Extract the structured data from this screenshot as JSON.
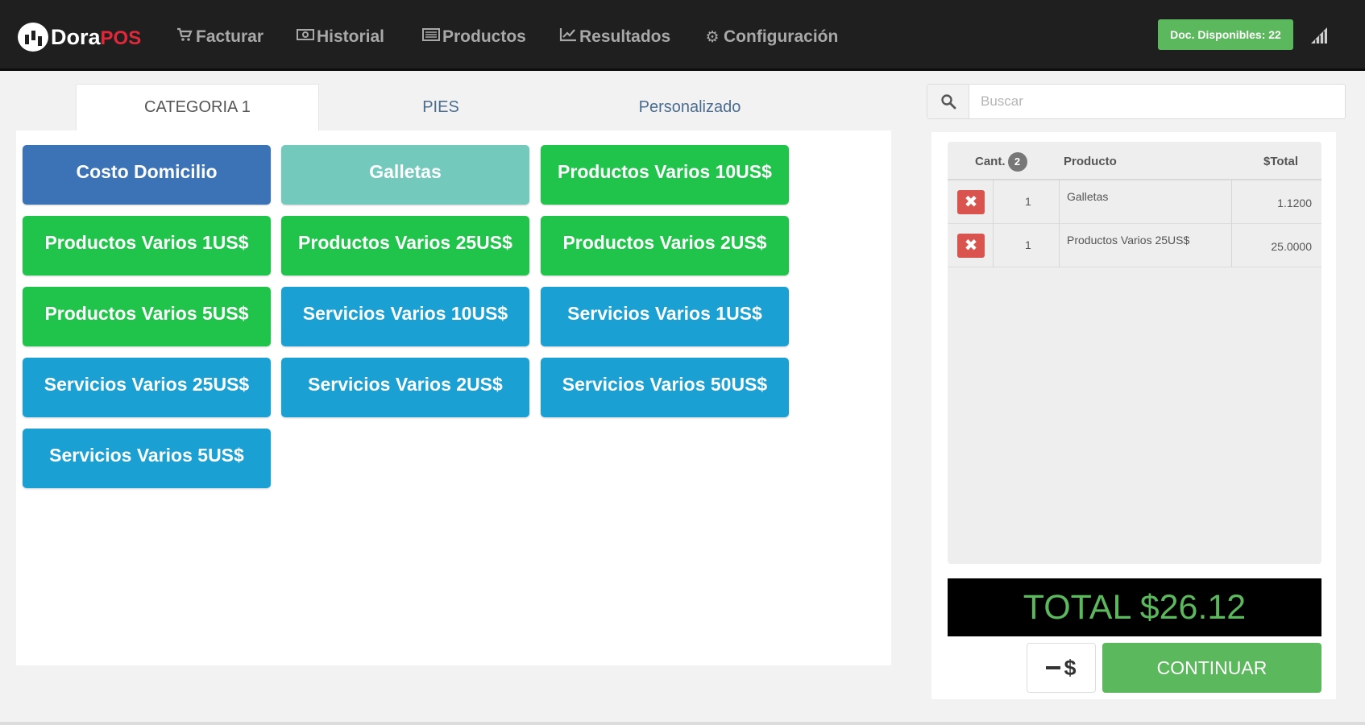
{
  "app": {
    "logo_primary": "Dora",
    "logo_secondary": "POS"
  },
  "nav": {
    "items": [
      {
        "label": "Facturar",
        "icon": "cart-icon"
      },
      {
        "label": "Historial",
        "icon": "money-icon"
      },
      {
        "label": "Productos",
        "icon": "list-icon"
      },
      {
        "label": "Resultados",
        "icon": "line-chart-icon"
      },
      {
        "label": "Configuración",
        "icon": "gear-icon"
      }
    ],
    "doc_badge": "Doc. Disponibles: 22"
  },
  "tabs": [
    {
      "label": "CATEGORIA 1",
      "active": true
    },
    {
      "label": "PIES",
      "active": false
    },
    {
      "label": "Personalizado",
      "active": false
    }
  ],
  "products": [
    {
      "label": "Costo Domicilio",
      "color": "#3c72b6"
    },
    {
      "label": "Galletas",
      "color": "#74c9bd"
    },
    {
      "label": "Productos Varios 10US$",
      "color": "#21c44a"
    },
    {
      "label": "Productos Varios 1US$",
      "color": "#21c44a"
    },
    {
      "label": "Productos Varios 25US$",
      "color": "#21c44a"
    },
    {
      "label": "Productos Varios 2US$",
      "color": "#21c44a"
    },
    {
      "label": "Productos Varios 5US$",
      "color": "#21c44a"
    },
    {
      "label": "Servicios Varios 10US$",
      "color": "#1ba0d3"
    },
    {
      "label": "Servicios Varios 1US$",
      "color": "#1ba0d3"
    },
    {
      "label": "Servicios Varios 25US$",
      "color": "#1ba0d3"
    },
    {
      "label": "Servicios Varios 2US$",
      "color": "#1ba0d3"
    },
    {
      "label": "Servicios Varios 50US$",
      "color": "#1ba0d3"
    },
    {
      "label": "Servicios Varios 5US$",
      "color": "#1ba0d3"
    }
  ],
  "search": {
    "placeholder": "Buscar",
    "value": ""
  },
  "order": {
    "columns": {
      "qty": "Cant.",
      "product": "Producto",
      "total": "$Total"
    },
    "item_count": "2",
    "items": [
      {
        "qty": "1",
        "product": "Galletas",
        "total": "1.1200"
      },
      {
        "qty": "1",
        "product": "Productos Varios 25US$",
        "total": "25.0000"
      }
    ],
    "total": "TOTAL $26.12",
    "currency_button": "$",
    "continue_button": "CONTINUAR"
  },
  "colors": {
    "navbar": "#1f1f1f",
    "accent_green": "#5cb85c",
    "danger": "#d9534f",
    "nav_text": "#a8a8a8"
  }
}
